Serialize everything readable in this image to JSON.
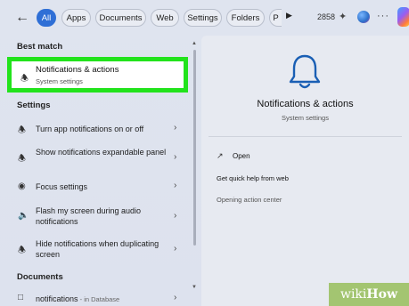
{
  "filters": {
    "back_icon": "arrow-left-icon",
    "chips": [
      {
        "label": "All",
        "active": true
      },
      {
        "label": "Apps",
        "active": false
      },
      {
        "label": "Documents",
        "active": false
      },
      {
        "label": "Web",
        "active": false
      },
      {
        "label": "Settings",
        "active": false
      },
      {
        "label": "Folders",
        "active": false
      },
      {
        "label": "P",
        "active": false
      }
    ],
    "more_glyph": "▶",
    "points": "2858",
    "more_options": "···"
  },
  "left": {
    "best_match_heading": "Best match",
    "best_match": {
      "title": "Notifications & actions",
      "subtitle": "System settings"
    },
    "settings_heading": "Settings",
    "settings_items": [
      {
        "label": "Turn app notifications on or off",
        "icon": "bell-icon"
      },
      {
        "label": "Show notifications expandable panel",
        "icon": "bell-icon"
      },
      {
        "label": "Focus settings",
        "icon": "focus-icon"
      },
      {
        "label": "Flash my screen during audio notifications",
        "icon": "speaker-icon"
      },
      {
        "label": "Hide notifications when duplicating screen",
        "icon": "bell-icon"
      }
    ],
    "documents_heading": "Documents",
    "document_item": {
      "name": "notifications",
      "location": " - in Database"
    }
  },
  "right": {
    "title": "Notifications & actions",
    "subtitle": "System settings",
    "actions": {
      "open": "Open",
      "help": "Get quick help from web",
      "related": "Opening action center"
    }
  },
  "watermark": {
    "brand_a": "wiki",
    "brand_b": "How"
  },
  "colors": {
    "accent": "#2f6fd6",
    "highlight": "#22e31c",
    "bell": "#1a5fb4"
  }
}
